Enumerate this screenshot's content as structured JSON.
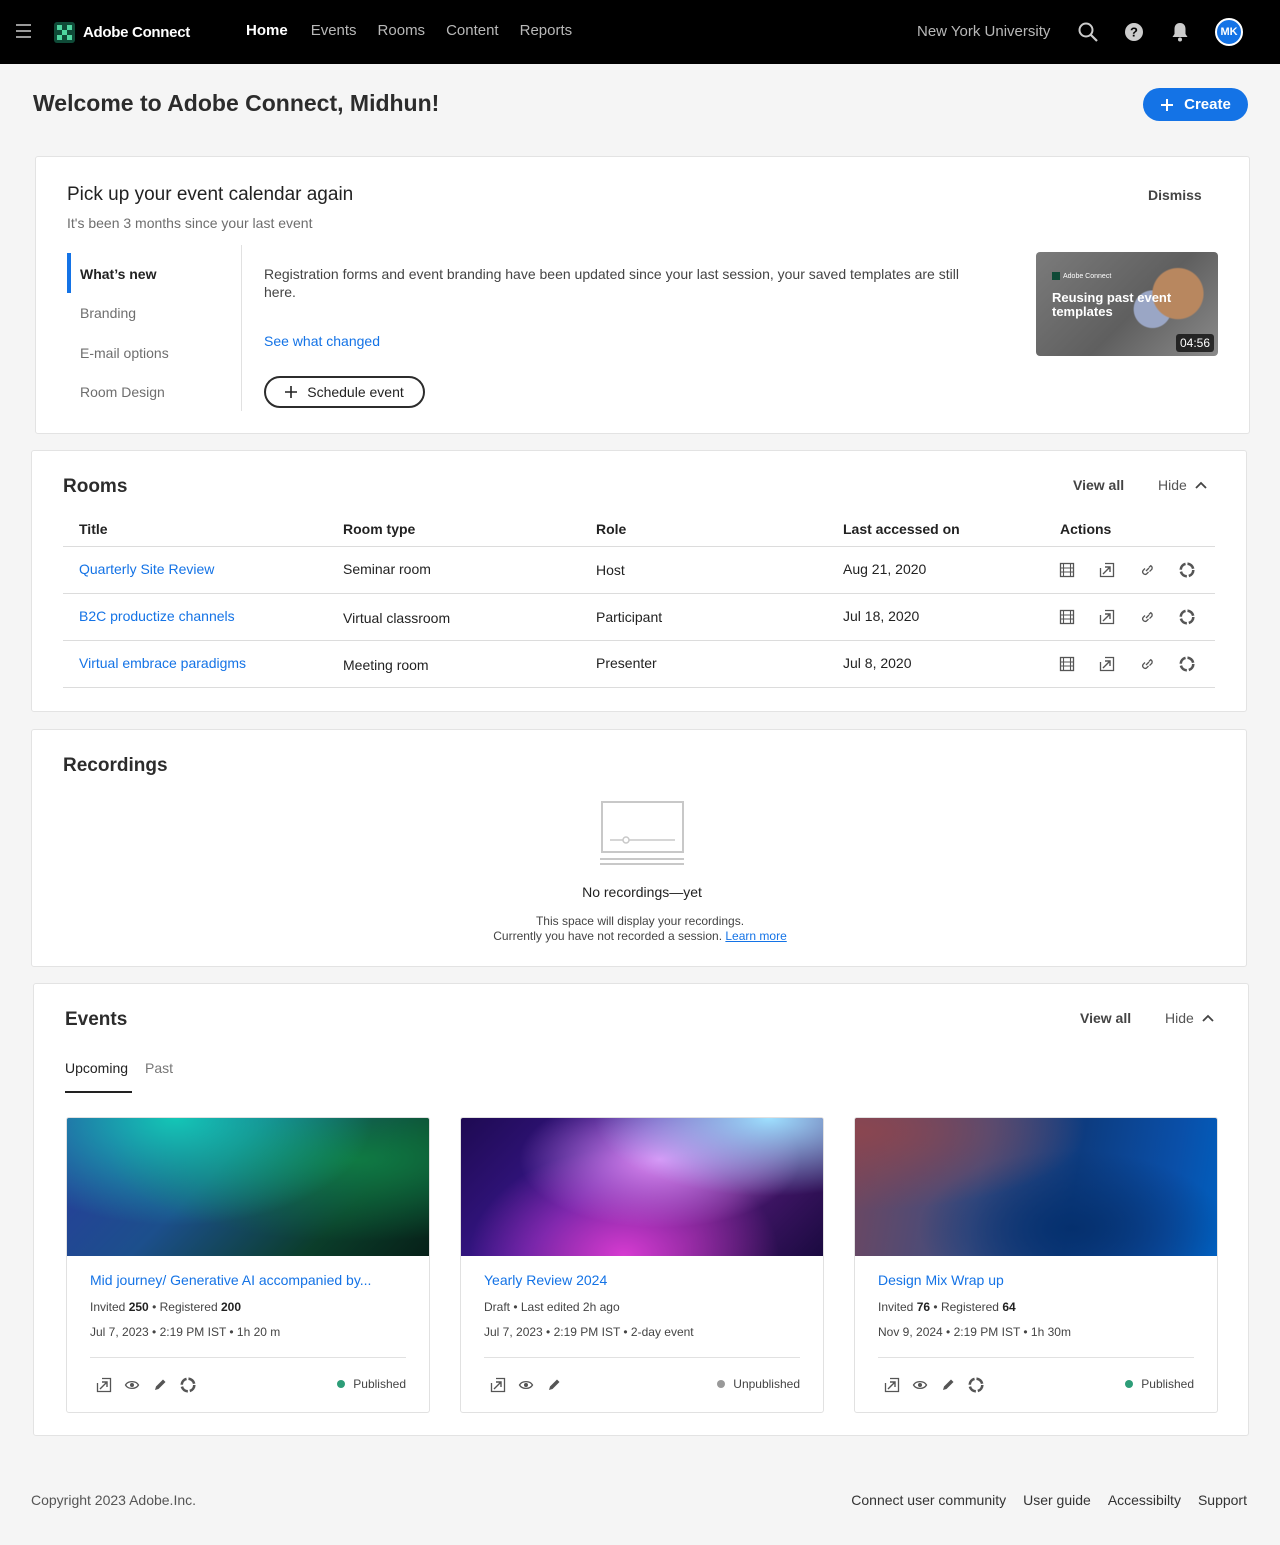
{
  "app": {
    "brand": "Adobe Connect",
    "org": "New York University",
    "user_initials": "MK",
    "accent": "#1473e6"
  },
  "nav": {
    "items": [
      "Home",
      "Events",
      "Rooms",
      "Content",
      "Reports"
    ],
    "active": "Home"
  },
  "welcome": {
    "title": "Welcome to Adobe Connect, Midhun!",
    "create_label": "Create"
  },
  "pickup": {
    "title": "Pick up your event calendar again",
    "subtitle": "It's been 3 months since your last event",
    "dismiss": "Dismiss",
    "menu": [
      "What’s new",
      "Branding",
      "E-mail options",
      "Room Design"
    ],
    "text": "Registration forms and event branding have been updated since your last session, your saved templates are still here.",
    "link": "See what changed",
    "schedule_label": "Schedule event",
    "video": {
      "brand": "Adobe Connect",
      "title": "Reusing past event templates",
      "duration": "04:56"
    }
  },
  "rooms": {
    "title": "Rooms",
    "view_all": "View all",
    "hide": "Hide",
    "columns": [
      "Title",
      "Room type",
      "Role",
      "Last accessed on",
      "Actions"
    ],
    "rows": [
      {
        "title": "Quarterly Site Review",
        "type": "Seminar room",
        "role": "Host",
        "date": "Aug 21, 2020"
      },
      {
        "title": "B2C productize channels",
        "type": "Virtual classroom",
        "role": "Participant",
        "date": "Jul 18, 2020"
      },
      {
        "title": "Virtual embrace paradigms",
        "type": "Meeting room",
        "role": "Presenter",
        "date": "Jul 8, 2020"
      }
    ]
  },
  "recordings": {
    "title": "Recordings",
    "empty_title": "No recordings—yet",
    "empty_line1": "This space will display your recordings.",
    "empty_line2": "Currently you have not recorded a session.",
    "learn_more": "Learn more"
  },
  "events": {
    "title": "Events",
    "view_all": "View all",
    "hide": "Hide",
    "tabs": [
      "Upcoming",
      "Past"
    ],
    "cards": [
      {
        "title": "Mid journey/ Generative AI accompanied by...",
        "invited_label": "Invited",
        "invited": "250",
        "registered_label": "Registered",
        "registered": "200",
        "meta": "Jul 7, 2023 • 2:19 PM IST • 1h 20 m",
        "status": "Published",
        "status_color": "#2d9d78"
      },
      {
        "title": "Yearly Review 2024",
        "draft_line": "Draft • Last edited 2h ago",
        "meta": "Jul 7, 2023 • 2:19 PM IST • 2-day event",
        "status": "Unpublished",
        "status_color": "#999999"
      },
      {
        "title": "Design Mix Wrap up",
        "invited_label": "Invited",
        "invited": "76",
        "registered_label": "Registered",
        "registered": "64",
        "meta": "Nov 9, 2024 • 2:19 PM IST • 1h 30m",
        "status": "Published",
        "status_color": "#2d9d78"
      }
    ]
  },
  "footer": {
    "copyright": "Copyright 2023 Adobe.Inc.",
    "links": [
      "Connect user community",
      "User guide",
      "Accessibilty",
      "Support"
    ]
  }
}
